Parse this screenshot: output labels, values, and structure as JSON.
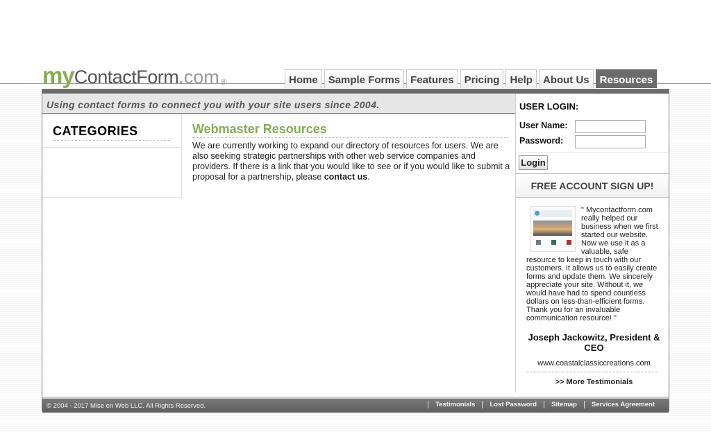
{
  "brand": {
    "my": "my",
    "contactform": "ContactForm",
    "dotcom": ".com",
    "reg": "®",
    "accent": "#86ad52"
  },
  "nav": {
    "tabs": [
      {
        "label": "Home"
      },
      {
        "label": "Sample Forms"
      },
      {
        "label": "Features"
      },
      {
        "label": "Pricing"
      },
      {
        "label": "Help"
      },
      {
        "label": "About Us"
      },
      {
        "label": "Resources",
        "active": true
      }
    ]
  },
  "tagline": "Using contact forms to connect you with your site users since 2004.",
  "categories": {
    "title": "CATEGORIES"
  },
  "main": {
    "title": "Webmaster Resources",
    "body": "We are currently working to expand our directory of resources for users. We are also seeking strategic partnerships with other web service companies and providers. If there is a link that you would like to see or if you would like to submit a proposal for a partnership, please ",
    "link": "contact us",
    "end": "."
  },
  "login": {
    "title": "USER LOGIN:",
    "username_label": "User Name:",
    "password_label": "Password:",
    "username_value": "",
    "password_value": "",
    "button": "Login"
  },
  "signup": "FREE ACCOUNT SIGN UP!",
  "testimonial": {
    "quote": "\" Mycontactform.com really helped our business when we first started our website. Now we use it as a valuable, safe resource to keep in touch with our customers. It allows us to easily create forms and update them. We sincerely appreciate your site. Without it, we would have had to spend countless dollars on less-than-efficient forms. Thank you for an invaluable communication resource! \"",
    "author": "Joseph Jackowitz, President & CEO",
    "site": "www.coastalclassiccreations.com",
    "more": ">> More Testimonials"
  },
  "footer": {
    "copyright": "© 2004 - 2017 Mise en Web LLC. All Rights Reserved.",
    "links": [
      "Testimonials",
      "Lost Password",
      "Sitemap",
      "Services Agreement"
    ]
  }
}
